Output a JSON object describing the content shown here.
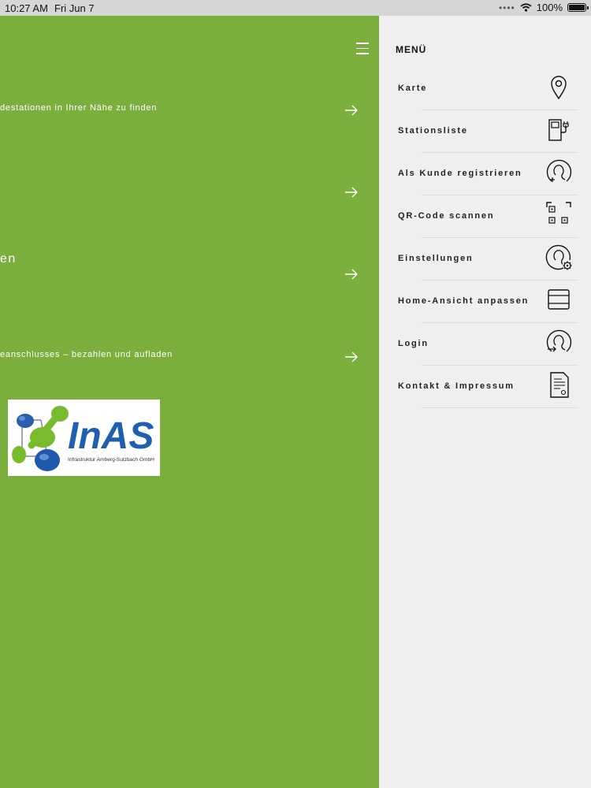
{
  "status_bar": {
    "time": "10:27 AM",
    "date": "Fri Jun 7",
    "battery": "100%"
  },
  "main": {
    "rows": [
      {
        "text": "destationen in Ihrer Nähe zu finden"
      },
      {
        "text": ""
      },
      {
        "heading": "en"
      },
      {
        "text": "eanschlusses – bezahlen und aufladen"
      }
    ],
    "logo": {
      "name": "InAS",
      "subtitle": "Infrastruktur Amberg-Sulzbach GmbH"
    }
  },
  "menu": {
    "title": "MENÜ",
    "items": [
      {
        "label": "Karte",
        "icon": "map-pin-icon"
      },
      {
        "label": "Stationsliste",
        "icon": "charging-station-icon"
      },
      {
        "label": "Als Kunde registrieren",
        "icon": "user-add-icon"
      },
      {
        "label": "QR-Code scannen",
        "icon": "qr-scan-icon"
      },
      {
        "label": "Einstellungen",
        "icon": "user-settings-icon"
      },
      {
        "label": "Home-Ansicht anpassen",
        "icon": "layout-icon"
      },
      {
        "label": "Login",
        "icon": "user-login-icon"
      },
      {
        "label": "Kontakt & Impressum",
        "icon": "document-icon"
      }
    ]
  },
  "colors": {
    "brand_green": "#7cae3e",
    "menu_bg": "#efeff1",
    "logo_blue": "#1e5ea8",
    "logo_green": "#7cbd2f"
  }
}
